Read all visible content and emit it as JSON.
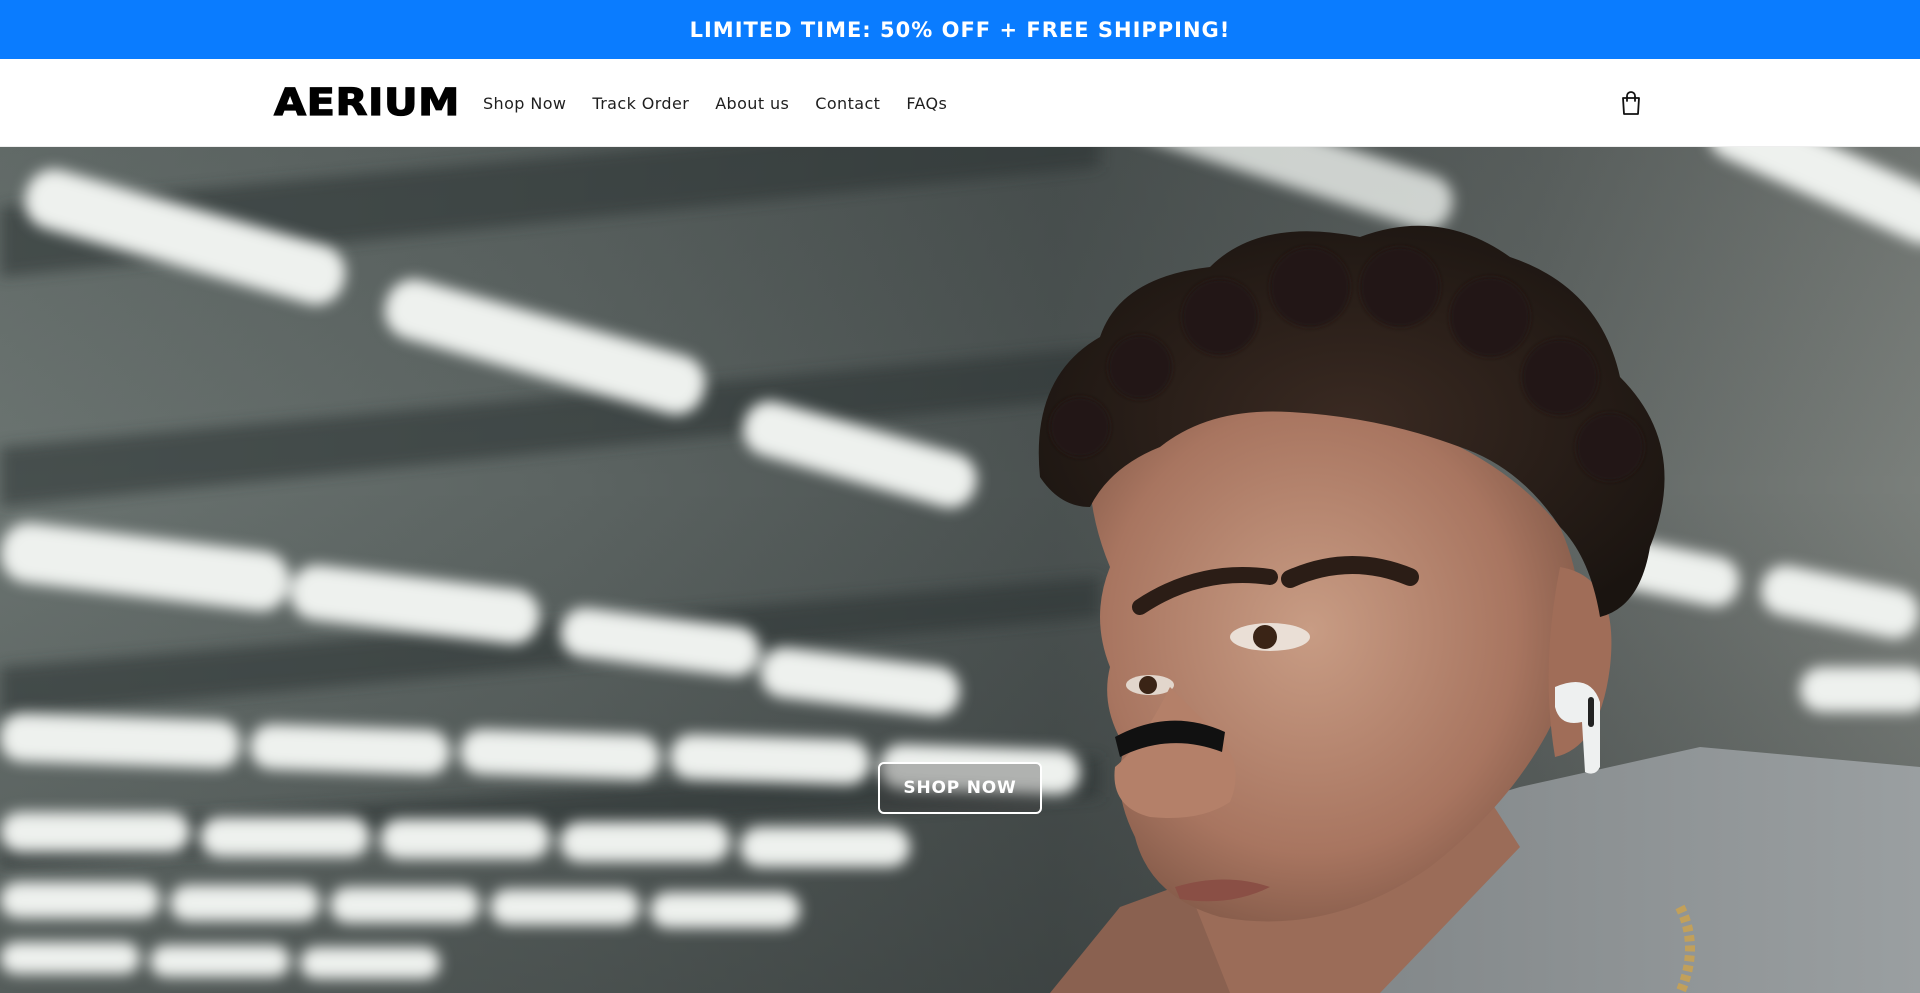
{
  "announcement": {
    "text": "LIMITED TIME: 50% OFF + FREE SHIPPING!",
    "background": "#0a7cff"
  },
  "header": {
    "logo": "AERIUM",
    "nav": [
      {
        "label": "Shop Now"
      },
      {
        "label": "Track Order"
      },
      {
        "label": "About us"
      },
      {
        "label": "Contact"
      },
      {
        "label": "FAQs"
      }
    ],
    "cart_icon": "shopping-bag-icon"
  },
  "hero": {
    "image": "man-with-nasal-strip-and-earbuds-in-gym",
    "cta_label": "SHOP NOW"
  }
}
